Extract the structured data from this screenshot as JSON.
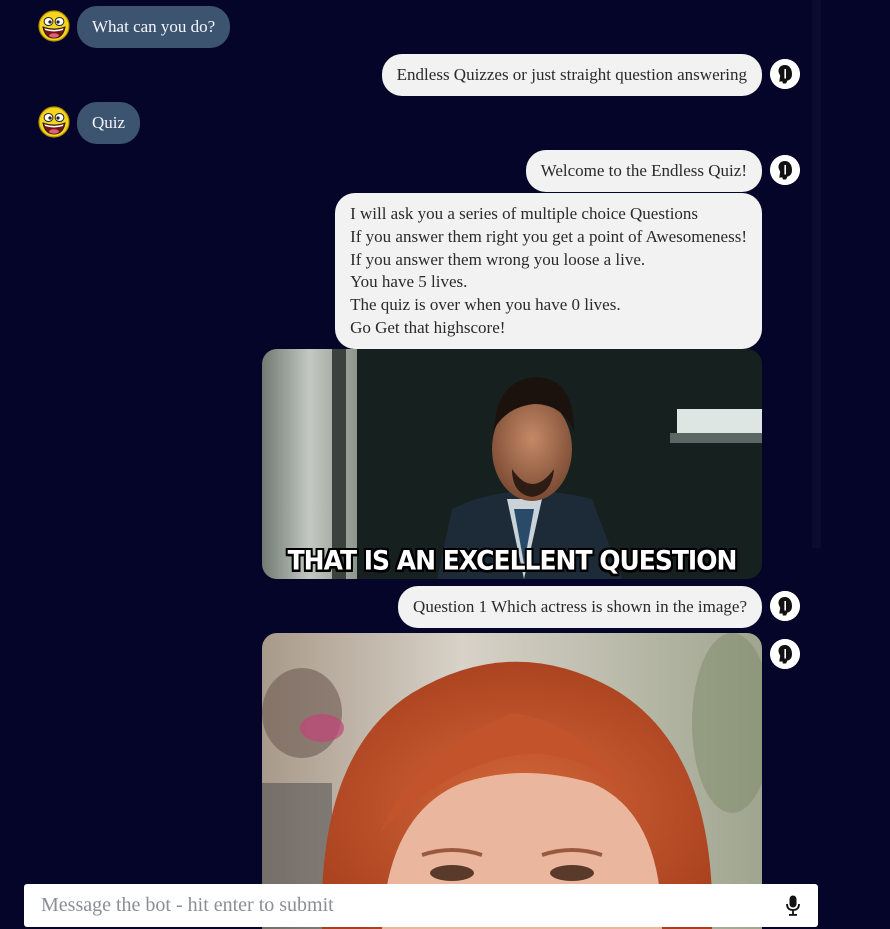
{
  "composer": {
    "placeholder": "Message the bot - hit enter to submit",
    "mic_icon": "microphone-icon"
  },
  "messages": [
    {
      "sender": "user",
      "text": "What can you do?",
      "avatar": "awesome-smiley-face"
    },
    {
      "sender": "bot",
      "text": "Endless Quizzes or just straight question answering",
      "avatar": "bot-head-icon"
    },
    {
      "sender": "user",
      "text": "Quiz",
      "avatar": "awesome-smiley-face"
    },
    {
      "sender": "bot",
      "text": "Welcome to the Endless Quiz!",
      "avatar": "bot-head-icon"
    },
    {
      "sender": "bot",
      "lines": [
        "I will ask you a series of multiple choice Questions",
        "If you answer them right you get a point of Awesomeness!",
        "If you answer them wrong you loose a live.",
        "You have 5 lives.",
        "The quiz is over when you have 0 lives.",
        "Go Get that highscore!"
      ]
    },
    {
      "sender": "bot",
      "type": "image",
      "caption": "THAT IS AN EXCELLENT QUESTION"
    },
    {
      "sender": "bot",
      "text": "Question 1 Which actress is shown in the image?",
      "avatar": "bot-head-icon"
    },
    {
      "sender": "bot",
      "type": "image",
      "avatar": "bot-head-icon"
    }
  ],
  "colors": {
    "background": "#05052a",
    "user_bubble": "#3d5470",
    "bot_bubble": "#f2f2f2"
  }
}
